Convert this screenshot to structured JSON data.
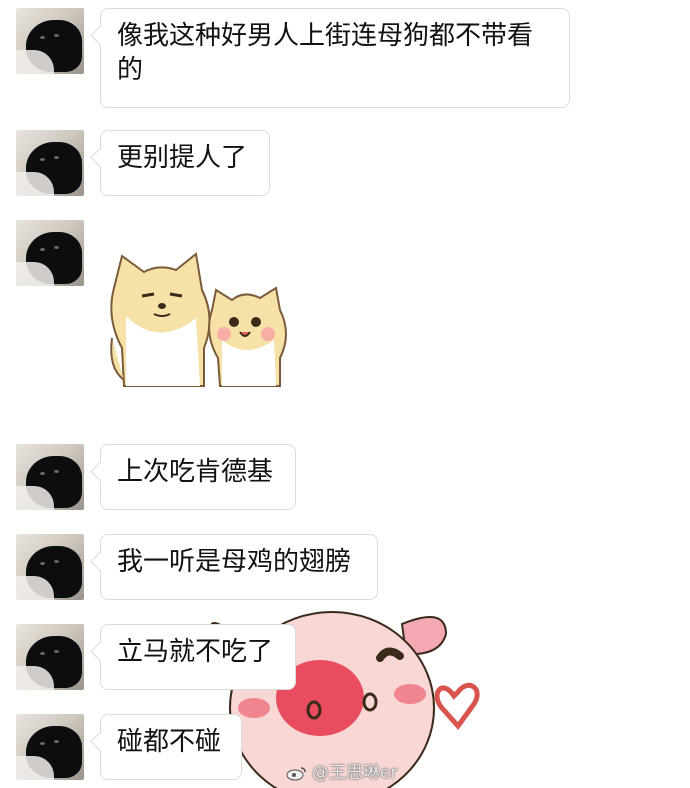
{
  "messages": [
    {
      "type": "text",
      "text": "像我这种好男人上街连母狗都不带看的"
    },
    {
      "type": "text",
      "text": "更别提人了"
    },
    {
      "type": "sticker",
      "sticker": "two-shiba-dogs-sticker"
    },
    {
      "type": "text",
      "text": "上次吃肯德基"
    },
    {
      "type": "text",
      "text": "我一听是母鸡的翅膀"
    },
    {
      "type": "text",
      "text": "立马就不吃了"
    },
    {
      "type": "text",
      "text": "碰都不碰"
    }
  ],
  "overlay_sticker": "pink-pig-with-heart-sticker",
  "watermark": {
    "at": "@",
    "name": "王思琳er",
    "icon": "weibo-icon"
  },
  "colors": {
    "bubble_border": "#dcdcdc",
    "pig_pink": "#f7c9cc",
    "pig_cheek": "#e8344a",
    "heart": "#d9534f"
  }
}
